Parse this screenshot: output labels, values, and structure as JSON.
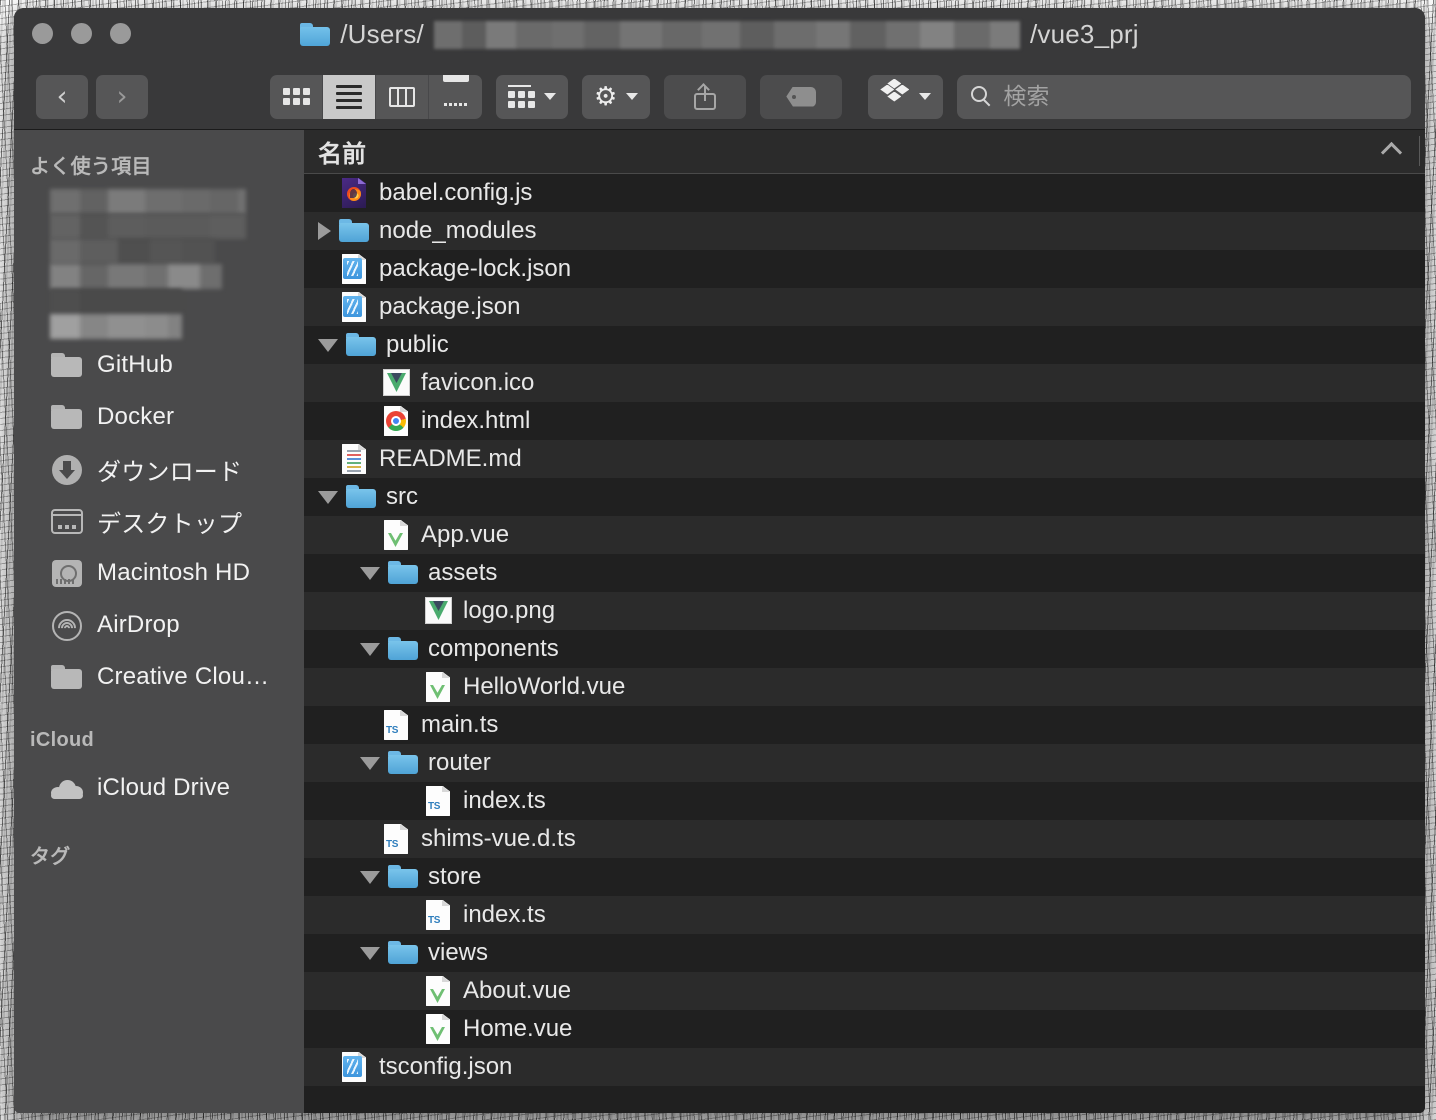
{
  "window": {
    "title_prefix": "/Users/",
    "title_suffix": "/vue3_prj",
    "title_redacted": true,
    "folder_icon": "folder-icon"
  },
  "toolbar": {
    "back_label": "‹",
    "forward_label": "›",
    "view_modes": [
      {
        "name": "icon-view",
        "icon": "grid-icon",
        "selected": false
      },
      {
        "name": "list-view",
        "icon": "list-icon",
        "selected": true
      },
      {
        "name": "column-view",
        "icon": "columns-icon",
        "selected": false
      },
      {
        "name": "gallery-view",
        "icon": "gallery-icon",
        "selected": false
      }
    ],
    "group_button": {
      "icon": "group-icon",
      "chevron": "chevron-down-icon"
    },
    "action_button": {
      "icon": "gear-icon",
      "chevron": "chevron-down-icon"
    },
    "share_button": {
      "icon": "share-icon",
      "enabled": false
    },
    "tag_button": {
      "icon": "tag-icon",
      "enabled": false
    },
    "dropbox_button": {
      "icon": "dropbox-icon",
      "chevron": "chevron-down-icon"
    }
  },
  "search": {
    "placeholder": "検索",
    "value": "",
    "icon": "search-icon"
  },
  "sidebar": {
    "sections": [
      {
        "header": "よく使う項目",
        "items": [
          {
            "label": "",
            "icon": "redacted",
            "redacted": true
          },
          {
            "label": "GitHub",
            "icon": "folder-icon"
          },
          {
            "label": "Docker",
            "icon": "folder-icon"
          },
          {
            "label": "ダウンロード",
            "icon": "downloads-icon"
          },
          {
            "label": "デスクトップ",
            "icon": "desktop-icon"
          },
          {
            "label": "Macintosh HD",
            "icon": "harddisk-icon"
          },
          {
            "label": "AirDrop",
            "icon": "airdrop-icon"
          },
          {
            "label": "Creative Clou…",
            "icon": "folder-icon"
          }
        ]
      },
      {
        "header": "iCloud",
        "items": [
          {
            "label": "iCloud Drive",
            "icon": "icloud-icon"
          }
        ]
      },
      {
        "header": "タグ",
        "items": []
      }
    ]
  },
  "filelist": {
    "column_header": "名前",
    "sort_icon": "chevron-up-icon",
    "rows": [
      {
        "name": "babel.config.js",
        "indent": 0,
        "icon": "firefox-js-file-icon",
        "disclosure": "none"
      },
      {
        "name": "node_modules",
        "indent": 0,
        "icon": "folder-icon",
        "disclosure": "closed"
      },
      {
        "name": "package-lock.json",
        "indent": 0,
        "icon": "json-file-icon",
        "disclosure": "none"
      },
      {
        "name": "package.json",
        "indent": 0,
        "icon": "json-file-icon",
        "disclosure": "none"
      },
      {
        "name": "public",
        "indent": 0,
        "icon": "folder-icon",
        "disclosure": "open"
      },
      {
        "name": "favicon.ico",
        "indent": 1,
        "icon": "vue-image-icon",
        "disclosure": "none"
      },
      {
        "name": "index.html",
        "indent": 1,
        "icon": "chrome-html-file-icon",
        "disclosure": "none"
      },
      {
        "name": "README.md",
        "indent": 0,
        "icon": "markdown-file-icon",
        "disclosure": "none"
      },
      {
        "name": "src",
        "indent": 0,
        "icon": "folder-icon",
        "disclosure": "open"
      },
      {
        "name": "App.vue",
        "indent": 1,
        "icon": "vue-file-icon",
        "disclosure": "none"
      },
      {
        "name": "assets",
        "indent": 1,
        "icon": "folder-icon",
        "disclosure": "open"
      },
      {
        "name": "logo.png",
        "indent": 2,
        "icon": "vue-image-icon",
        "disclosure": "none"
      },
      {
        "name": "components",
        "indent": 1,
        "icon": "folder-icon",
        "disclosure": "open"
      },
      {
        "name": "HelloWorld.vue",
        "indent": 2,
        "icon": "vue-file-icon",
        "disclosure": "none"
      },
      {
        "name": "main.ts",
        "indent": 1,
        "icon": "ts-file-icon",
        "disclosure": "none"
      },
      {
        "name": "router",
        "indent": 1,
        "icon": "folder-icon",
        "disclosure": "open"
      },
      {
        "name": "index.ts",
        "indent": 2,
        "icon": "ts-file-icon",
        "disclosure": "none"
      },
      {
        "name": "shims-vue.d.ts",
        "indent": 1,
        "icon": "ts-file-icon",
        "disclosure": "none"
      },
      {
        "name": "store",
        "indent": 1,
        "icon": "folder-icon",
        "disclosure": "open"
      },
      {
        "name": "index.ts",
        "indent": 2,
        "icon": "ts-file-icon",
        "disclosure": "none"
      },
      {
        "name": "views",
        "indent": 1,
        "icon": "folder-icon",
        "disclosure": "open"
      },
      {
        "name": "About.vue",
        "indent": 2,
        "icon": "vue-file-icon",
        "disclosure": "none"
      },
      {
        "name": "Home.vue",
        "indent": 2,
        "icon": "vue-file-icon",
        "disclosure": "none"
      },
      {
        "name": "tsconfig.json",
        "indent": 0,
        "icon": "json-file-icon",
        "disclosure": "none"
      }
    ]
  },
  "colors": {
    "folder_blue": "#4fa3d6",
    "window_chrome": "#39393a",
    "sidebar_bg": "#4a4a4b",
    "list_bg": "#1e1e1e",
    "row_alt": "#2b2b2b",
    "vue_green": "#4aab6e",
    "ts_blue": "#2f7ebd"
  }
}
